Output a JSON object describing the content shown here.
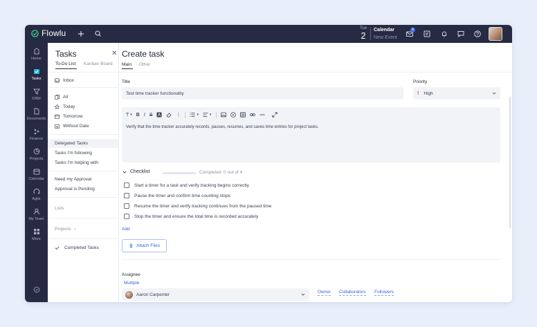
{
  "app": {
    "name": "Flowlu"
  },
  "topbar": {
    "date": {
      "weekday": "Tue",
      "day": "2"
    },
    "calendar": {
      "title": "Calendar",
      "subtitle": "New Event"
    },
    "notification_badge": "9",
    "icons": [
      "plus-icon",
      "search-icon",
      "mail-icon",
      "chat-icon",
      "bell-icon",
      "message-icon",
      "help-icon"
    ]
  },
  "rail": {
    "items": [
      {
        "label": "Home",
        "icon": "home-icon"
      },
      {
        "label": "Tasks",
        "icon": "tasks-icon",
        "active": true
      },
      {
        "label": "CRM",
        "icon": "crm-icon"
      },
      {
        "label": "Documents",
        "icon": "documents-icon"
      },
      {
        "label": "Finance",
        "icon": "finance-icon"
      },
      {
        "label": "Projects",
        "icon": "projects-icon"
      },
      {
        "label": "Calendar",
        "icon": "calendar-icon"
      },
      {
        "label": "Agile",
        "icon": "agile-icon"
      },
      {
        "label": "My Team",
        "icon": "team-icon"
      },
      {
        "label": "More",
        "icon": "more-icon"
      }
    ]
  },
  "tasks_panel": {
    "title": "Tasks",
    "tabs": [
      "To-Do List",
      "Kanban Board"
    ],
    "inbox": "Inbox",
    "filters": [
      "All",
      "Today",
      "Tomorrow",
      "Without Date"
    ],
    "delegated": [
      "Delegated Tasks",
      "Tasks I'm following",
      "Tasks I'm helping with"
    ],
    "approval": [
      "Need my Approval",
      "Approval is Pending"
    ],
    "lists": "Lists",
    "projects": "Projects",
    "completed": "Completed Tasks"
  },
  "form": {
    "heading": "Create task",
    "tabs": [
      "Main",
      "Other"
    ],
    "title_label": "Title",
    "title_value": "Test time tracker functionality",
    "priority_label": "Priority",
    "priority_value": "High",
    "description": "Verify that the time tracker accurately records, pauses, resumes, and saves time entries for project tasks.",
    "checklist": {
      "title": "Checklist",
      "progress_text": "Completed: 0 out of 4",
      "progress_fraction": 0,
      "items": [
        "Start a timer for a task and verify tracking begins correctly",
        "Pause the timer and confirm time counting stops",
        "Resume the timer and verify tracking continues from the paused time",
        "Stop the timer and ensure the total time is recorded accurately"
      ],
      "add_label": "Add"
    },
    "attach_label": "Attach Files",
    "assignee_label": "Assignee",
    "multiple_label": "Multiple",
    "assignee_value": "Aaron Carpenter",
    "role_links": [
      "Owner",
      "Collaborators",
      "Followers"
    ]
  },
  "colors": {
    "sidebar": "#262a42",
    "accent": "#3b62e0",
    "priority_high": "#d93a3a"
  }
}
